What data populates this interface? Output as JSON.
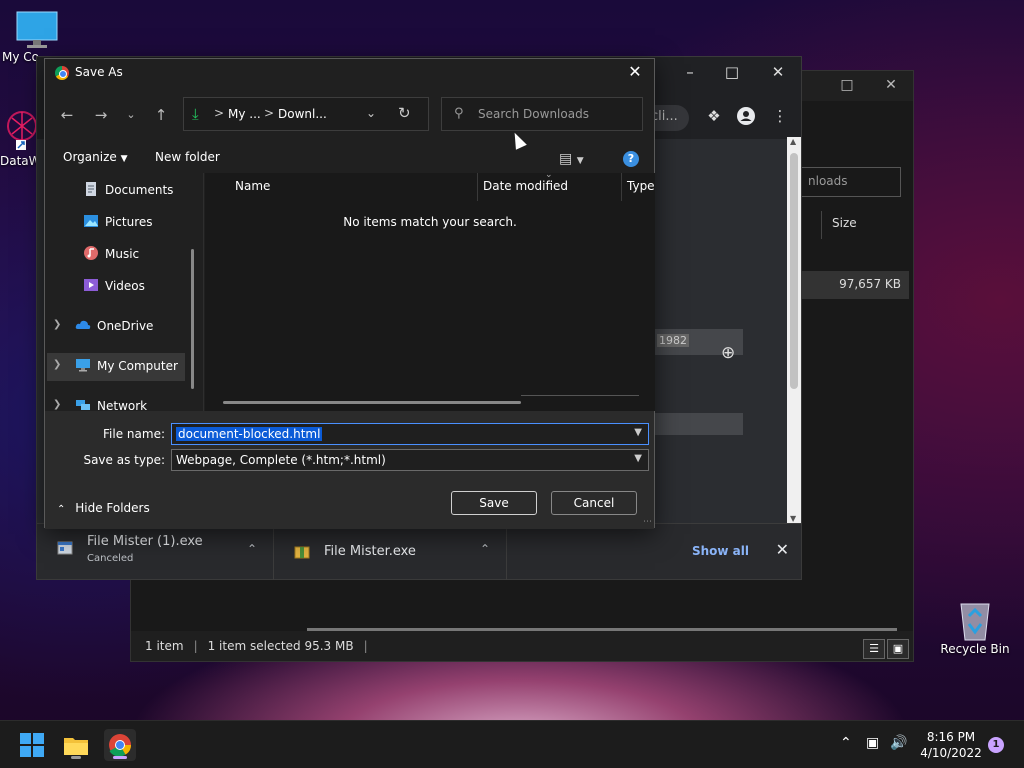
{
  "desktop": {
    "icons": [
      {
        "label": "My Co"
      },
      {
        "label": "DataW"
      },
      {
        "label": "Recycle Bin"
      }
    ]
  },
  "background_explorer": {
    "search_placeholder": "nloads",
    "column_size": "Size",
    "row_size": "97,657 KB",
    "status_count": "1 item",
    "status_selected": "1 item selected  95.3 MB",
    "status_sep": "|"
  },
  "chrome": {
    "omnibox_tail": "cli...",
    "content_value": "1982",
    "downloads": [
      {
        "name": "File Mister (1).exe",
        "status": "Canceled"
      },
      {
        "name": "File Mister.exe",
        "status": ""
      }
    ],
    "show_all": "Show all"
  },
  "dialog": {
    "title": "Save As",
    "breadcrumb": [
      "My ...",
      "Downl..."
    ],
    "breadcrumb_sep": ">",
    "search_placeholder": "Search Downloads",
    "organize": "Organize",
    "new_folder": "New folder",
    "nav_items": [
      {
        "label": "Documents",
        "pinned": true
      },
      {
        "label": "Pictures",
        "pinned": true
      },
      {
        "label": "Music",
        "pinned": false
      },
      {
        "label": "Videos",
        "pinned": false
      },
      {
        "label": "OneDrive",
        "pinned": false
      },
      {
        "label": "My Computer",
        "pinned": false
      },
      {
        "label": "Network",
        "pinned": false
      }
    ],
    "columns": [
      "Name",
      "Date modified",
      "Type"
    ],
    "empty_message": "No items match your search.",
    "file_name_label": "File name:",
    "file_name_value": "document-blocked.html",
    "save_as_type_label": "Save as type:",
    "save_as_type_value": "Webpage, Complete (*.htm;*.html)",
    "hide_folders": "Hide Folders",
    "save_button": "Save",
    "cancel_button": "Cancel"
  },
  "taskbar": {
    "time": "8:16 PM",
    "date": "4/10/2022",
    "notification_count": "1"
  },
  "colors": {
    "accent_blue": "#0b5bd7",
    "link_blue": "#8ab4f8",
    "download_green": "#23c45e"
  }
}
